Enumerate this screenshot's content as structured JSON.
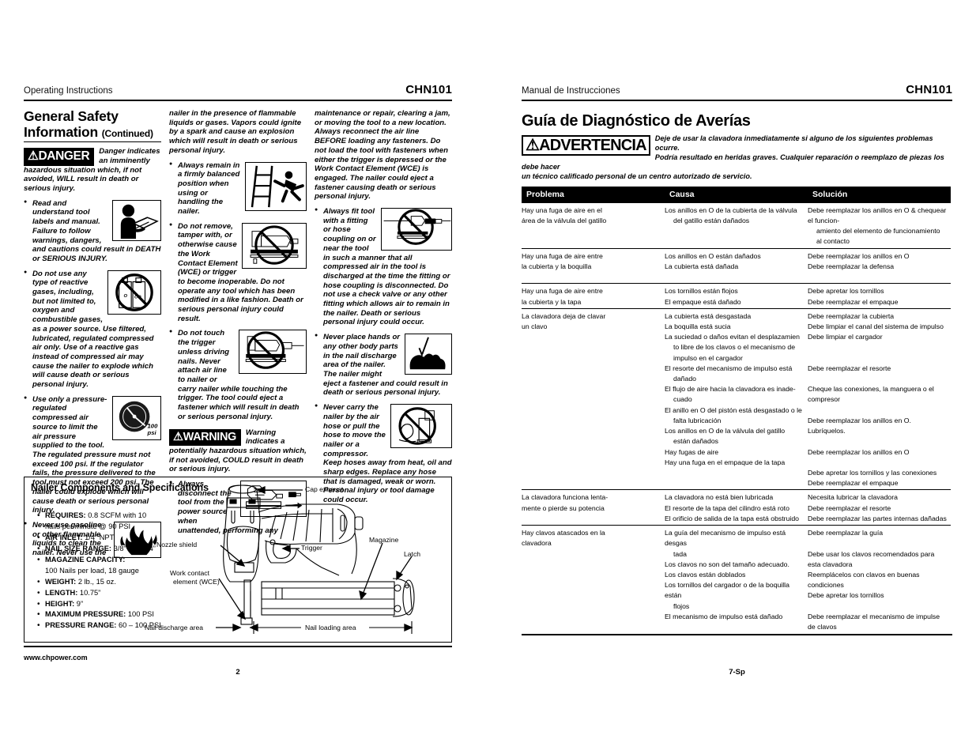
{
  "left_page": {
    "running_head": "Operating Instructions",
    "model": "CHN101",
    "section_title": "General Safety Information",
    "section_continued": "(Continued)",
    "danger": {
      "signal_word": "DANGER",
      "definition": "Danger indicates an imminently hazardous situation which, if not avoided, WILL result in death or serious injury."
    },
    "warning": {
      "signal_word": "WARNING",
      "definition": "Warning indicates a potentially hazardous situation which, if not avoided, COULD result in death or serious injury."
    },
    "column1_bullets": [
      "Read and understand tool labels and manual. Failure to follow warnings, dangers, and cautions could result in DEATH or SERIOUS INJURY.",
      "Do not use any type of reactive gases, including, but not limited to, oxygen and combustible gases, as a power source. Use filtered, lubricated, regulated compressed air only. Use of a reactive gas instead of compressed air may cause the nailer to explode which will cause death or serious personal injury.",
      "Use only a pressure-regulated compressed air source to limit the air pressure supplied to the tool. The regulated pressure must not exceed 100 psi. If the regulator fails, the pressure delivered to the tool must not exceed 200 psi. The nailer could explode which will cause death or serious personal injury.",
      "Never use gasoline or other flammable liquids to clean the nailer. Never use the"
    ],
    "column2_lead": "nailer in the presence of flammable liquids or gases. Vapors could ignite by a spark and cause an explosion which will result in death or serious personal injury.",
    "column2_bullets": [
      "Always remain in a firmly balanced position when using or handling the nailer.",
      "Do not remove, tamper with, or otherwise cause the Work Contact Element (WCE) or trigger to become inoperable. Do not operate any tool which has been modified in a like fashion. Death or serious personal injury could result.",
      "Do not touch the trigger unless driving nails. Never attach air line to nailer or carry nailer while touching the trigger. The tool could eject a fastener which will result in death or serious personal injury."
    ],
    "column2_after_warning": [
      "Always disconnect the tool from the power source when unattended, performing any"
    ],
    "column3_lead": "maintenance or repair, clearing a jam, or moving the tool to a new location. Always reconnect the air line BEFORE loading any fasteners. Do not load the tool with fasteners when either the trigger is depressed or the Work Contact Element (WCE) is engaged. The nailer could eject a fastener causing death or serious personal injury.",
    "column3_bullets": [
      "Always fit tool with a fitting or hose coupling on or near the tool in such a manner that all compressed air in the tool is discharged at the time the fitting or hose coupling is disconnected. Do not use a check valve or any other fitting which allows air to remain in the nailer. Death or serious personal injury could occur.",
      "Never place hands or any other body parts in the nail discharge area of the nailer. The nailer might eject a fastener and could result in death or serious personal injury.",
      "Never carry the nailer by the air hose or pull the hose to move the nailer or a compressor. Keep hoses away from heat, oil and sharp edges. Replace any hose that is damaged, weak or worn. Personal injury or tool damage could occur."
    ],
    "spec_box": {
      "title": "Nailer Components and Specifications",
      "specs": [
        {
          "label": "REQUIRES:",
          "value": "0.8 SCFM with 10",
          "cont": "nails per minute @ 90 PSI"
        },
        {
          "label": "AIR INLET:",
          "value": "1/4” NPT",
          "cont": ""
        },
        {
          "label": "NAIL SIZE RANGE:",
          "value": "3/8” to 1-1/4”",
          "cont": ""
        },
        {
          "label": "MAGAZINE CAPACITY:",
          "value": "",
          "cont": "100 Nails per load, 18 gauge"
        },
        {
          "label": "WEIGHT:",
          "value": "2 lb., 15 oz.",
          "cont": ""
        },
        {
          "label": "LENGTH:",
          "value": "10.75”",
          "cont": ""
        },
        {
          "label": "HEIGHT:",
          "value": "9”",
          "cont": ""
        },
        {
          "label": "MAXIMUM PRESSURE:",
          "value": "100 PSI",
          "cont": ""
        },
        {
          "label": "PRESSURE RANGE:",
          "value": "60 – 100 PSI",
          "cont": ""
        }
      ],
      "callouts": {
        "cap_exhaust": "Cap exhaust",
        "nozzle_shield": "Nozzle shield",
        "trigger": "Trigger",
        "magazine": "Magazine",
        "latch": "Latch",
        "wce_line1": "Work contact",
        "wce_line2": "element (WCE)",
        "nail_discharge": "Nail discharge area",
        "nail_loading": "Nail loading area"
      }
    },
    "footer_url": "www.chpower.com",
    "page_number": "2"
  },
  "right_page": {
    "running_head": "Manual de Instrucciones",
    "model": "CHN101",
    "section_title": "Guía de Diagnóstico de Averías",
    "advertencia": {
      "signal_word": "ADVERTENCIA",
      "line1": "Deje de usar la clavadora inmediatamente si alguno de los siguientes problemas ocurre.",
      "line2": "Podría resultado en heridas graves. Cualquier reparación o reemplazo de piezas los debe hacer",
      "line3": "un técnico calificado personal de un centro autorizado de servicio."
    },
    "table": {
      "headers": [
        "Problema",
        "Causa",
        "Solución"
      ],
      "groups": [
        {
          "problem": [
            "Hay una fuga de aire en el",
            "área de la válvula del gatillo"
          ],
          "rows": [
            {
              "cause": [
                "Los anillos en O de la cubierta de la válvula",
                "del gatillo están dañados"
              ],
              "solution": [
                "Debe reemplazar los anillos en O & chequear el funcion-",
                "amiento del elemento de funcionamiento al contacto"
              ]
            }
          ]
        },
        {
          "problem": [
            "Hay una fuga de aire entre",
            "la cubierta y la boquilla"
          ],
          "rows": [
            {
              "cause": [
                "Los anillos en O están dañados"
              ],
              "solution": [
                "Debe reemplazar los anillos en O"
              ]
            },
            {
              "cause": [
                "La cubierta está dañada"
              ],
              "solution": [
                "Debe reemplazar la defensa"
              ]
            },
            {
              "cause": [
                ""
              ],
              "solution": [
                ""
              ]
            }
          ]
        },
        {
          "problem": [
            "Hay una fuga de aire entre",
            "la cubierta y la tapa"
          ],
          "rows": [
            {
              "cause": [
                "Los tornillos están flojos"
              ],
              "solution": [
                "Debe apretar los tornillos"
              ]
            },
            {
              "cause": [
                "El empaque está dañado"
              ],
              "solution": [
                "Debe reemplazar el empaque"
              ]
            }
          ]
        },
        {
          "problem": [
            "La clavadora deja de clavar",
            "un clavo"
          ],
          "rows": [
            {
              "cause": [
                "La cubierta está desgastada"
              ],
              "solution": [
                "Debe reemplazar la cubierta"
              ]
            },
            {
              "cause": [
                "La boquilla está sucia"
              ],
              "solution": [
                "Debe limpiar el canal del sistema de impulso"
              ]
            },
            {
              "cause": [
                "La suciedad o daños evitan el desplazamien",
                "to libre de los clavos o el mecanismo de",
                "impulso en el cargador"
              ],
              "solution": [
                "Debe limpiar el cargador"
              ]
            },
            {
              "cause": [
                "El resorte del mecanismo de impulso está",
                "dañado"
              ],
              "solution": [
                "Debe reemplazar el resorte"
              ]
            },
            {
              "cause": [
                "El flujo de aire hacia la clavadora es inade-",
                "cuado"
              ],
              "solution": [
                "Cheque las conexiones, la manguera o el compresor"
              ]
            },
            {
              "cause": [
                "El anillo en O del pistón está desgastado o le",
                "falta lubricación"
              ],
              "solution": [
                "Debe reemplazar los anillos en O. Lubríquelos."
              ]
            },
            {
              "cause": [
                "Los anillos en O de la válvula del gatillo",
                "están dañados"
              ],
              "solution": [
                "Debe reemplazar los anillos en O"
              ]
            },
            {
              "cause": [
                "Hay fugas de aire"
              ],
              "solution": [
                "Debe apretar los tornillos y las conexiones"
              ]
            },
            {
              "cause": [
                "Hay una fuga en el empaque de la tapa"
              ],
              "solution": [
                "Debe reemplazar el empaque"
              ]
            }
          ]
        },
        {
          "problem": [
            "La clavadora funciona lenta-",
            "mente o pierde su potencia"
          ],
          "rows": [
            {
              "cause": [
                "La clavadora no está bien lubricada"
              ],
              "solution": [
                "Necesita lubricar la clavadora"
              ]
            },
            {
              "cause": [
                "El resorte de la tapa del cilindro está roto"
              ],
              "solution": [
                "Debe reemplazar el resorte"
              ]
            },
            {
              "cause": [
                "El orificio de salida de la tapa está obstruido"
              ],
              "solution": [
                "Debe reemplazar las partes internas dañadas"
              ]
            }
          ]
        },
        {
          "problem": [
            "Hay clavos atascados en la",
            "clavadora"
          ],
          "rows": [
            {
              "cause": [
                "La guía del mecanismo de impulso está desgas",
                "tada"
              ],
              "solution": [
                "Debe reemplazar la guía"
              ]
            },
            {
              "cause": [
                "Los clavos no son del tamaño adecuado."
              ],
              "solution": [
                "Debe usar los clavos recomendados para esta clavadora"
              ]
            },
            {
              "cause": [
                "Los clavos están doblados"
              ],
              "solution": [
                "Reemplácelos con clavos en buenas condiciones"
              ]
            },
            {
              "cause": [
                "Los tornillos del cargador o de la boquilla están",
                "flojos"
              ],
              "solution": [
                "Debe apretar los tornillos"
              ]
            },
            {
              "cause": [
                "El mecanismo de impulso está dañado"
              ],
              "solution": [
                "Debe reemplazar el mecanismo de impulse de clavos"
              ]
            }
          ]
        }
      ]
    },
    "page_number": "7-Sp"
  }
}
